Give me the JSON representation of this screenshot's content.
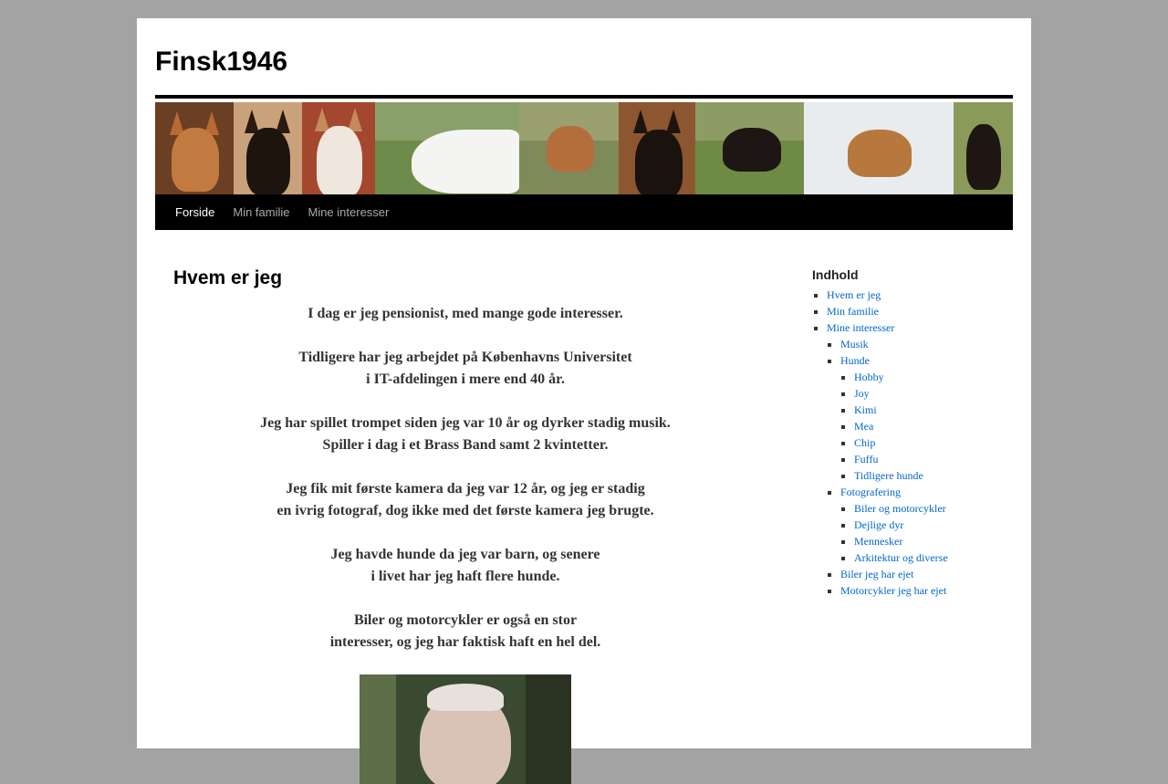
{
  "site": {
    "title": "Finsk1946"
  },
  "nav": {
    "items": [
      {
        "label": "Forside",
        "current": true
      },
      {
        "label": "Min familie",
        "current": false
      },
      {
        "label": "Mine interesser",
        "current": false
      }
    ]
  },
  "page": {
    "title": "Hvem er jeg",
    "paragraphs": [
      [
        "I dag er jeg pensionist, med mange gode interesser."
      ],
      [
        "Tidligere har jeg arbejdet på Københavns Universitet",
        "i IT-afdelingen i mere end 40 år."
      ],
      [
        "Jeg har spillet trompet siden jeg var 10 år og dyrker stadig musik.",
        "Spiller i dag i et Brass Band samt 2 kvintetter."
      ],
      [
        "Jeg fik mit første kamera da jeg var 12 år, og jeg er stadig",
        "en ivrig fotograf, dog ikke med det første kamera jeg brugte."
      ],
      [
        "Jeg havde hunde da jeg var barn, og senere",
        "i livet har jeg haft flere hunde."
      ],
      [
        "Biler og motorcykler er også en stor",
        "interesser, og jeg har faktisk haft en hel del."
      ]
    ]
  },
  "sidebar": {
    "heading": "Indhold",
    "items": [
      {
        "label": "Hvem er jeg"
      },
      {
        "label": "Min familie"
      },
      {
        "label": "Mine interesser",
        "children": [
          {
            "label": "Musik"
          },
          {
            "label": "Hunde",
            "children": [
              {
                "label": "Hobby"
              },
              {
                "label": "Joy"
              },
              {
                "label": "Kimi"
              },
              {
                "label": "Mea"
              },
              {
                "label": "Chip"
              },
              {
                "label": "Fuffu"
              },
              {
                "label": "Tidligere hunde"
              }
            ]
          },
          {
            "label": "Fotografering",
            "children": [
              {
                "label": "Biler og motorcykler"
              },
              {
                "label": "Dejlige dyr"
              },
              {
                "label": "Mennesker"
              },
              {
                "label": "Arkitektur og diverse"
              }
            ]
          },
          {
            "label": "Biler jeg har ejet"
          },
          {
            "label": "Motorcykler jeg har ejet"
          }
        ]
      }
    ]
  },
  "colors": {
    "background": "#a3a3a3",
    "link": "#0066cc",
    "nav_bg": "#000000"
  }
}
